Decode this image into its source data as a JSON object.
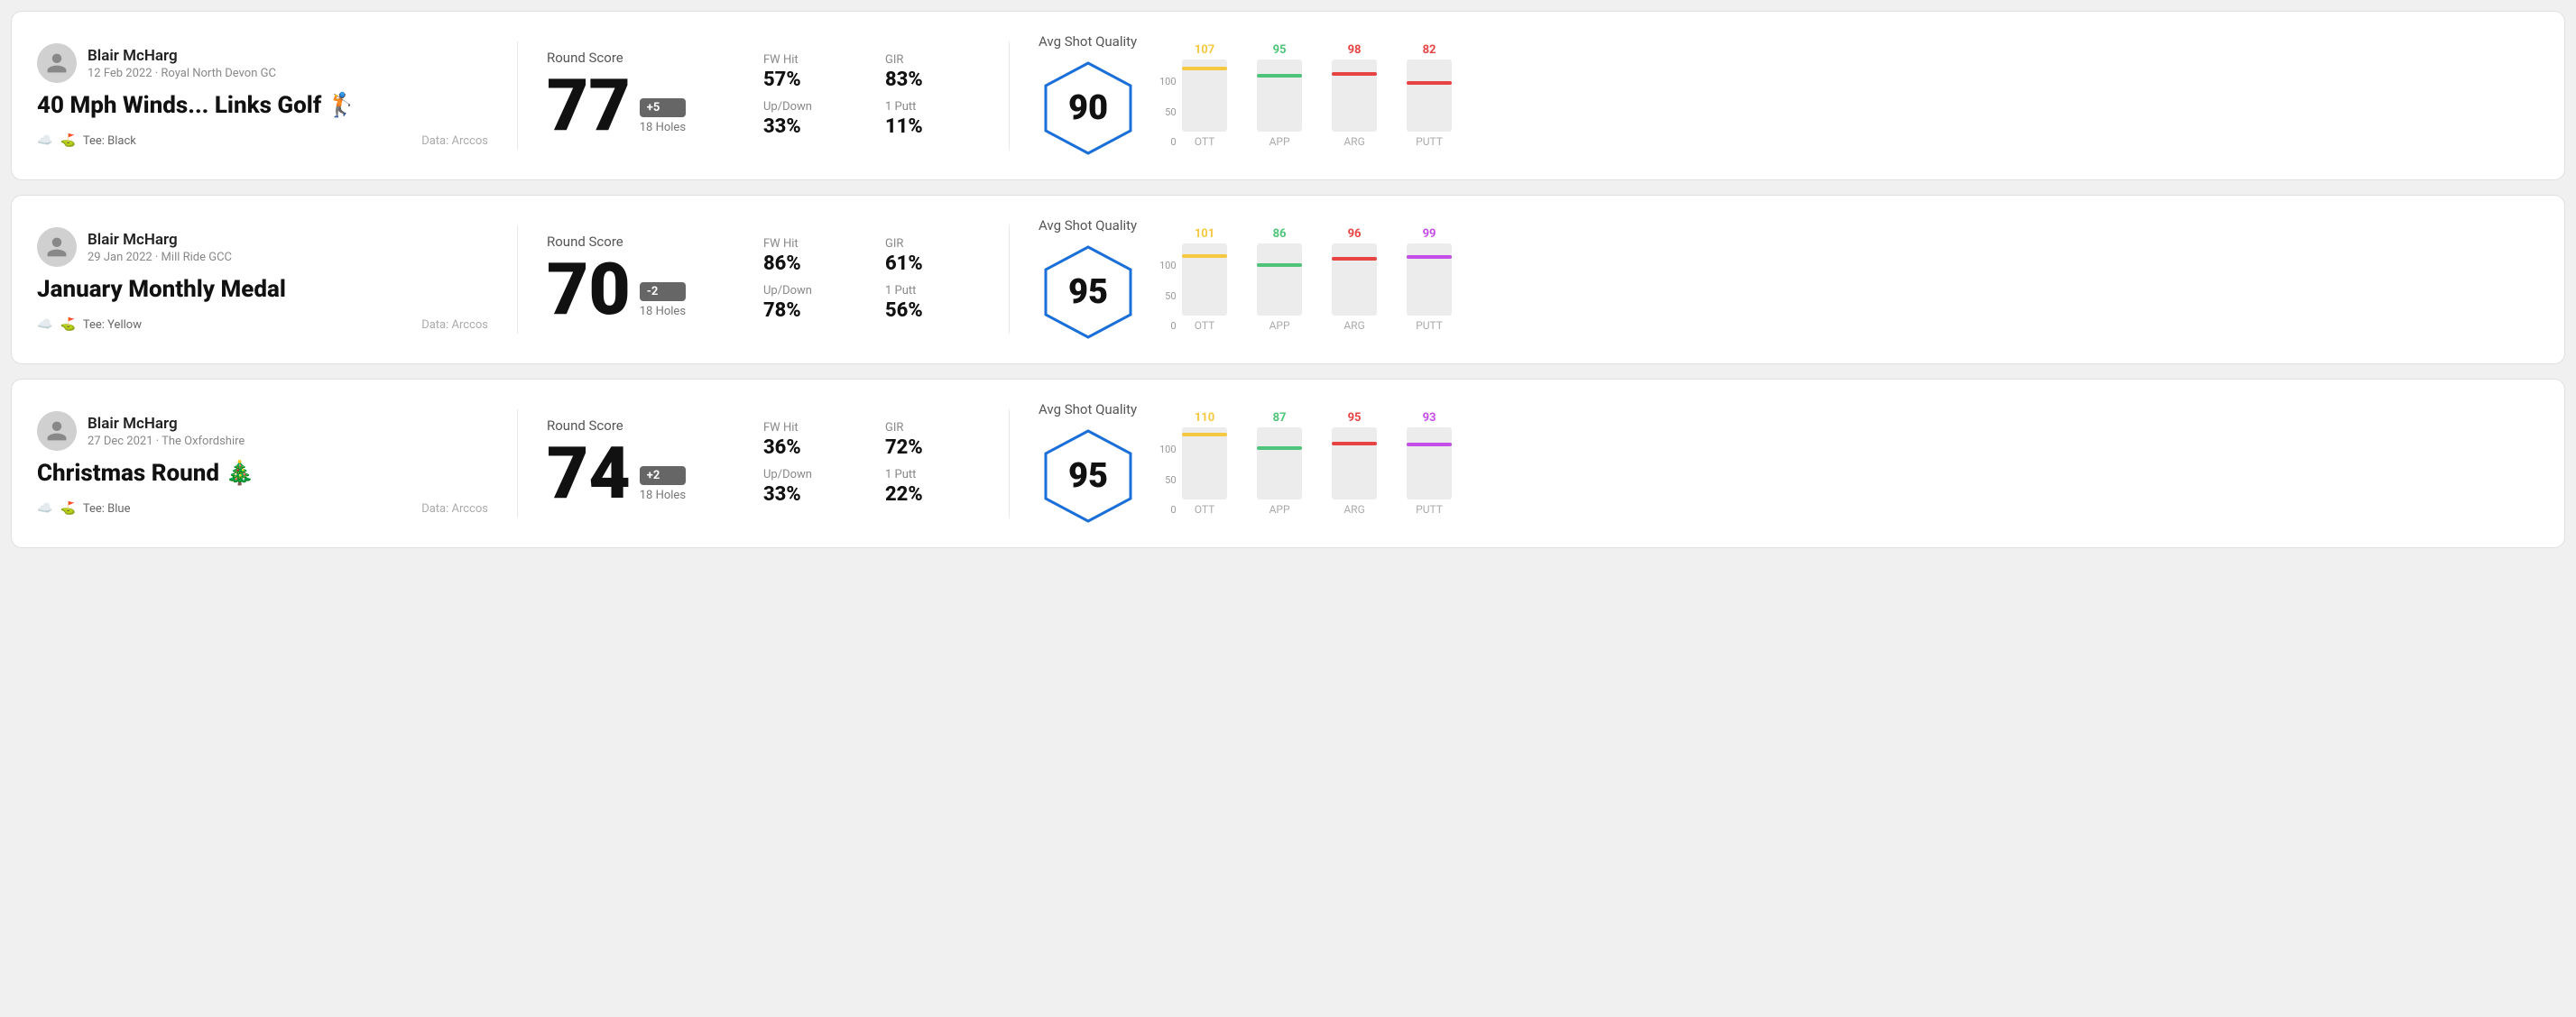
{
  "cards": [
    {
      "id": "card1",
      "user": {
        "name": "Blair McHarg",
        "date": "12 Feb 2022 · Royal North Devon GC"
      },
      "title": "40 Mph Winds... Links Golf",
      "titleEmoji": "🏌️",
      "tee": "Black",
      "dataSource": "Data: Arccos",
      "score": {
        "label": "Round Score",
        "value": "77",
        "badge": "+5",
        "badgeType": "positive",
        "holes": "18 Holes"
      },
      "stats": {
        "fwHitLabel": "FW Hit",
        "fwHitValue": "57%",
        "girLabel": "GIR",
        "girValue": "83%",
        "upDownLabel": "Up/Down",
        "upDownValue": "33%",
        "puttLabel": "1 Putt",
        "puttValue": "11%"
      },
      "quality": {
        "label": "Avg Shot Quality",
        "score": "90",
        "bars": [
          {
            "label": "OTT",
            "value": 107,
            "color": "#f5c842",
            "maxDisplay": 120
          },
          {
            "label": "APP",
            "value": 95,
            "color": "#4dc47a",
            "maxDisplay": 120
          },
          {
            "label": "ARG",
            "value": 98,
            "color": "#e84343",
            "maxDisplay": 120
          },
          {
            "label": "PUTT",
            "value": 82,
            "color": "#e84343",
            "maxDisplay": 120
          }
        ]
      }
    },
    {
      "id": "card2",
      "user": {
        "name": "Blair McHarg",
        "date": "29 Jan 2022 · Mill Ride GCC"
      },
      "title": "January Monthly Medal",
      "titleEmoji": "",
      "tee": "Yellow",
      "dataSource": "Data: Arccos",
      "score": {
        "label": "Round Score",
        "value": "70",
        "badge": "-2",
        "badgeType": "negative",
        "holes": "18 Holes"
      },
      "stats": {
        "fwHitLabel": "FW Hit",
        "fwHitValue": "86%",
        "girLabel": "GIR",
        "girValue": "61%",
        "upDownLabel": "Up/Down",
        "upDownValue": "78%",
        "puttLabel": "1 Putt",
        "puttValue": "56%"
      },
      "quality": {
        "label": "Avg Shot Quality",
        "score": "95",
        "bars": [
          {
            "label": "OTT",
            "value": 101,
            "color": "#f5c842",
            "maxDisplay": 120
          },
          {
            "label": "APP",
            "value": 86,
            "color": "#4dc47a",
            "maxDisplay": 120
          },
          {
            "label": "ARG",
            "value": 96,
            "color": "#e84343",
            "maxDisplay": 120
          },
          {
            "label": "PUTT",
            "value": 99,
            "color": "#c44de8",
            "maxDisplay": 120
          }
        ]
      }
    },
    {
      "id": "card3",
      "user": {
        "name": "Blair McHarg",
        "date": "27 Dec 2021 · The Oxfordshire"
      },
      "title": "Christmas Round",
      "titleEmoji": "🎄",
      "tee": "Blue",
      "dataSource": "Data: Arccos",
      "score": {
        "label": "Round Score",
        "value": "74",
        "badge": "+2",
        "badgeType": "positive",
        "holes": "18 Holes"
      },
      "stats": {
        "fwHitLabel": "FW Hit",
        "fwHitValue": "36%",
        "girLabel": "GIR",
        "girValue": "72%",
        "upDownLabel": "Up/Down",
        "upDownValue": "33%",
        "puttLabel": "1 Putt",
        "puttValue": "22%"
      },
      "quality": {
        "label": "Avg Shot Quality",
        "score": "95",
        "bars": [
          {
            "label": "OTT",
            "value": 110,
            "color": "#f5c842",
            "maxDisplay": 120
          },
          {
            "label": "APP",
            "value": 87,
            "color": "#4dc47a",
            "maxDisplay": 120
          },
          {
            "label": "ARG",
            "value": 95,
            "color": "#e84343",
            "maxDisplay": 120
          },
          {
            "label": "PUTT",
            "value": 93,
            "color": "#c44de8",
            "maxDisplay": 120
          }
        ]
      }
    }
  ],
  "labels": {
    "y100": "100",
    "y50": "50",
    "y0": "0"
  }
}
